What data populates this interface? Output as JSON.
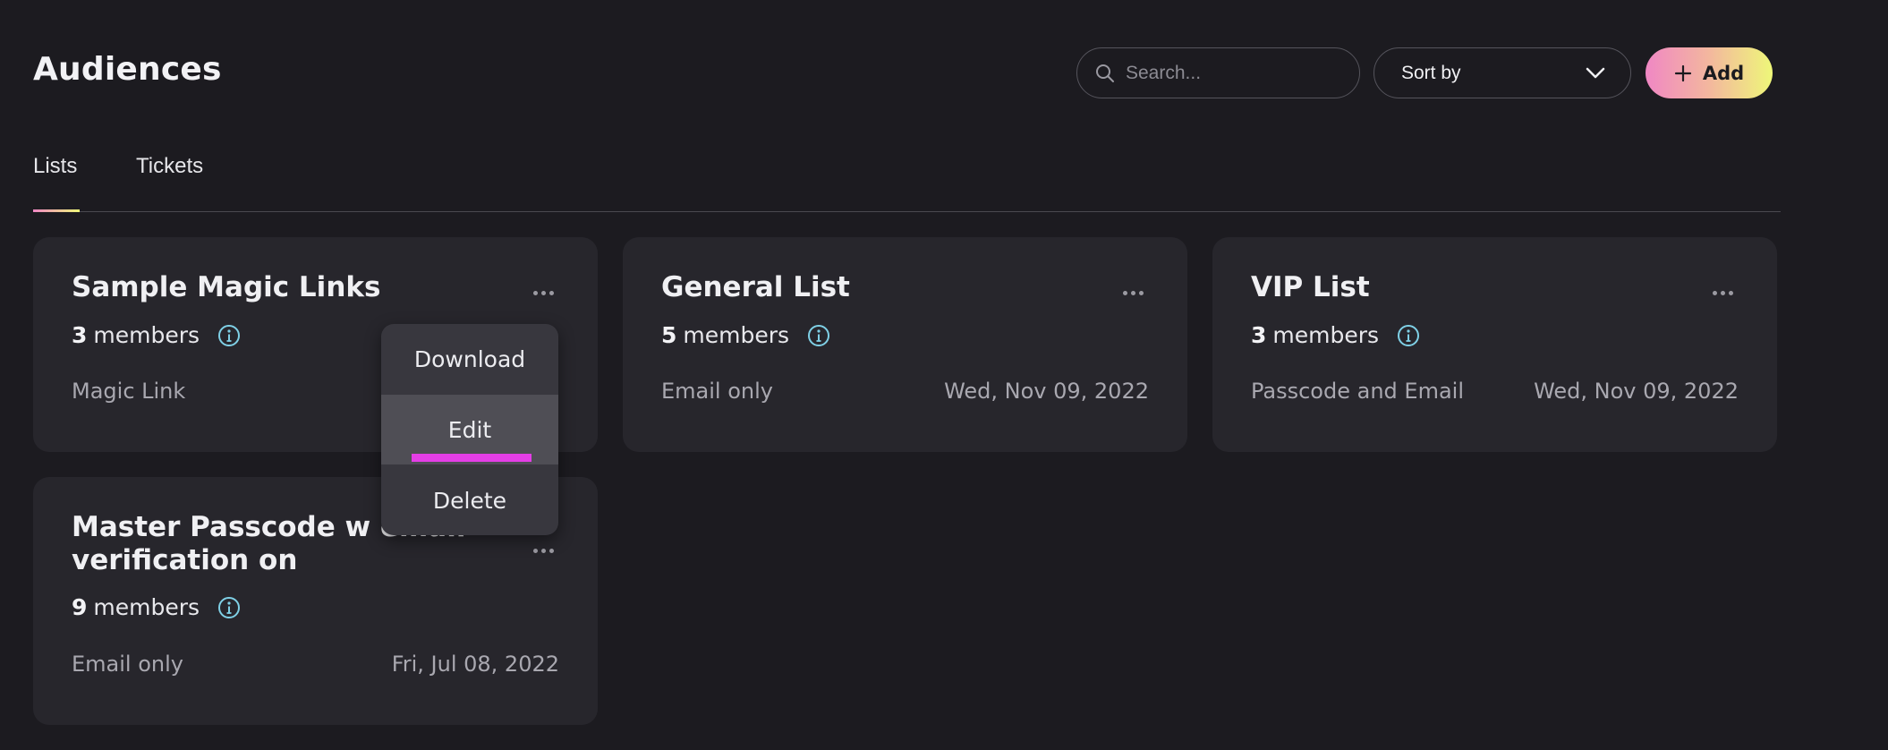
{
  "page": {
    "title": "Audiences"
  },
  "search": {
    "placeholder": "Search...",
    "icon": "search-icon"
  },
  "sort": {
    "label": "Sort by",
    "icon": "chevron-down-icon"
  },
  "add_button": {
    "label": "Add",
    "icon": "plus-icon"
  },
  "tabs": [
    {
      "label": "Lists",
      "active": true
    },
    {
      "label": "Tickets",
      "active": false
    }
  ],
  "cards": [
    {
      "title": "Sample Magic Links",
      "member_count": "3",
      "members_word": "members",
      "auth_type": "Magic Link",
      "date": ""
    },
    {
      "title": "General List",
      "member_count": "5",
      "members_word": "members",
      "auth_type": "Email only",
      "date": "Wed, Nov 09, 2022"
    },
    {
      "title": "VIP List",
      "member_count": "3",
      "members_word": "members",
      "auth_type": "Passcode and Email",
      "date": "Wed, Nov 09, 2022"
    },
    {
      "title": "Master Passcode w email verification on",
      "member_count": "9",
      "members_word": "members",
      "auth_type": "Email only",
      "date": "Fri, Jul 08, 2022"
    }
  ],
  "context_menu": {
    "items": [
      {
        "label": "Download",
        "active": false
      },
      {
        "label": "Edit",
        "active": true
      },
      {
        "label": "Delete",
        "active": false
      }
    ]
  },
  "colors": {
    "background": "#1c1b20",
    "card": "#27262c",
    "info_icon": "#7fd0e6",
    "accent_gradient_start": "#f087c4",
    "accent_gradient_end": "#eef779",
    "menu_highlight": "#e43ee6"
  }
}
